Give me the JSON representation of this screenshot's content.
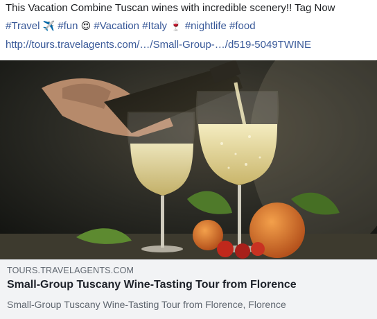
{
  "post": {
    "message": "This Vacation Combine Tuscan wines with incredible scenery!! Tag Now",
    "tags": {
      "travel": "#Travel",
      "travel_emoji": "✈️",
      "fun": "#fun",
      "fun_emoji": "😍",
      "vacation": "#Vacation",
      "italy": "#Italy",
      "italy_emoji": "🍷",
      "nightlife": "#nightlife",
      "food": "#food"
    },
    "url": "http://tours.travelagents.com/…/Small-Group-…/d519-5049TWINE"
  },
  "link_preview": {
    "domain": "TOURS.TRAVELAGENTS.COM",
    "title": "Small-Group Tuscany Wine-Tasting Tour from Florence",
    "description": "Small-Group Tuscany Wine-Tasting Tour from Florence, Florence"
  },
  "colors": {
    "link": "#385898",
    "preview_bg": "#f2f3f5",
    "muted_text": "#606770"
  }
}
